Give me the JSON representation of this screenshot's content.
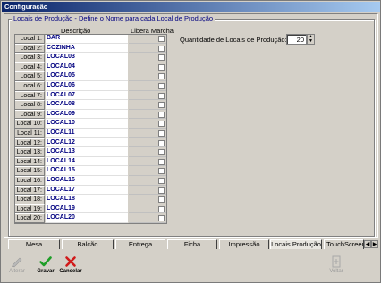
{
  "window": {
    "title": "Configuração"
  },
  "group": {
    "legend": "Locais de Produção - Define o Nome para cada Local de Produção"
  },
  "columns": {
    "descricao": "Descrição",
    "libera": "Libera Marcha"
  },
  "rows": [
    {
      "label": "Local 1:",
      "value": "BAR"
    },
    {
      "label": "Local 2:",
      "value": "COZINHA"
    },
    {
      "label": "Local 3:",
      "value": "LOCAL03"
    },
    {
      "label": "Local 4:",
      "value": "LOCAL04"
    },
    {
      "label": "Local 5:",
      "value": "LOCAL05"
    },
    {
      "label": "Local 6:",
      "value": "LOCAL06"
    },
    {
      "label": "Local 7:",
      "value": "LOCAL07"
    },
    {
      "label": "Local 8:",
      "value": "LOCAL08"
    },
    {
      "label": "Local 9:",
      "value": "LOCAL09"
    },
    {
      "label": "Local 10:",
      "value": "LOCAL10"
    },
    {
      "label": "Local 11:",
      "value": "LOCAL11"
    },
    {
      "label": "Local 12:",
      "value": "LOCAL12"
    },
    {
      "label": "Local 13:",
      "value": "LOCAL13"
    },
    {
      "label": "Local 14:",
      "value": "LOCAL14"
    },
    {
      "label": "Local 15:",
      "value": "LOCAL15"
    },
    {
      "label": "Local 16:",
      "value": "LOCAL16"
    },
    {
      "label": "Local 17:",
      "value": "LOCAL17"
    },
    {
      "label": "Local 18:",
      "value": "LOCAL18"
    },
    {
      "label": "Local 19:",
      "value": "LOCAL19"
    },
    {
      "label": "Local 20:",
      "value": "LOCAL20"
    }
  ],
  "quantity": {
    "label": "Quantidade de Locais de Produção:",
    "value": "20"
  },
  "tabs": [
    {
      "label": "Mesa"
    },
    {
      "label": "Balcão"
    },
    {
      "label": "Entrega"
    },
    {
      "label": "Ficha"
    },
    {
      "label": "Impressão"
    },
    {
      "label": "Locais Produção"
    },
    {
      "label": "TouchScreen"
    }
  ],
  "toolbar": {
    "alterar": "Alterar",
    "gravar": "Gravar",
    "cancelar": "Cancelar",
    "voltar": "Voltar"
  },
  "icons": {
    "alterar": "pencil-icon",
    "gravar": "check-icon",
    "cancelar": "x-icon",
    "voltar": "exit-icon",
    "tab_prev": "chevron-left-icon",
    "tab_next": "chevron-right-icon"
  },
  "colors": {
    "titlebar": "#0a246a",
    "check_green": "#1e9e28",
    "cancel_red": "#d11a1a",
    "value_text": "#000080"
  }
}
